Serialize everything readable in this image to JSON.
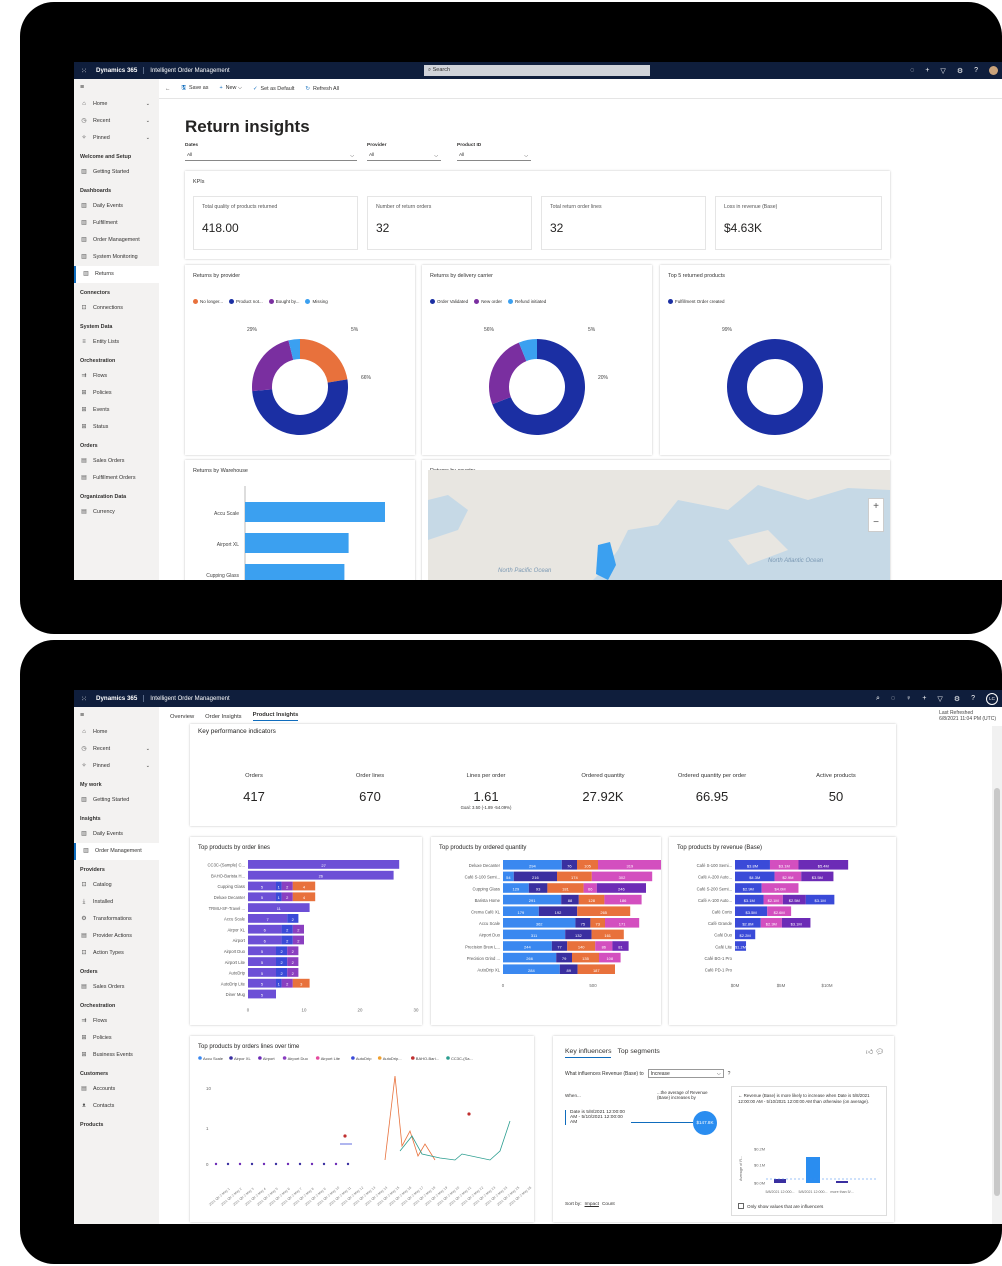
{
  "screen1": {
    "topbar": {
      "brand": "Dynamics 365",
      "app": "Intelligent Order Management",
      "search_placeholder": "Search"
    },
    "nav": [
      {
        "type": "item",
        "icon": "home-icon",
        "glyph": "⌂",
        "label": "Home",
        "chev": "⌄"
      },
      {
        "type": "item",
        "icon": "clock-icon",
        "glyph": "◷",
        "label": "Recent",
        "chev": "⌄"
      },
      {
        "type": "item",
        "icon": "pin-icon",
        "glyph": "✧",
        "label": "Pinned",
        "chev": "⌄"
      },
      {
        "type": "header",
        "label": "Welcome and Setup"
      },
      {
        "type": "item",
        "icon": "dashboard-icon",
        "glyph": "▥",
        "label": "Getting Started"
      },
      {
        "type": "header",
        "label": "Dashboards"
      },
      {
        "type": "item",
        "icon": "dashboard-icon",
        "glyph": "▥",
        "label": "Daily Events"
      },
      {
        "type": "item",
        "icon": "dashboard-icon",
        "glyph": "▥",
        "label": "Fulfillment"
      },
      {
        "type": "item",
        "icon": "dashboard-icon",
        "glyph": "▥",
        "label": "Order Management"
      },
      {
        "type": "item",
        "icon": "dashboard-icon",
        "glyph": "▥",
        "label": "System Monitoring"
      },
      {
        "type": "item",
        "icon": "dashboard-icon",
        "glyph": "▥",
        "label": "Returns",
        "selected": true
      },
      {
        "type": "header",
        "label": "Connectors"
      },
      {
        "type": "item",
        "icon": "connection-icon",
        "glyph": "⊡",
        "label": "Connections"
      },
      {
        "type": "header",
        "label": "System Data"
      },
      {
        "type": "item",
        "icon": "list-icon",
        "glyph": "≡",
        "label": "Entity Lists"
      },
      {
        "type": "header",
        "label": "Orchestration"
      },
      {
        "type": "item",
        "icon": "flow-icon",
        "glyph": "⇉",
        "label": "Flows"
      },
      {
        "type": "item",
        "icon": "policy-icon",
        "glyph": "⊞",
        "label": "Policies"
      },
      {
        "type": "item",
        "icon": "event-icon",
        "glyph": "⊞",
        "label": "Events"
      },
      {
        "type": "item",
        "icon": "status-icon",
        "glyph": "⊞",
        "label": "Status"
      },
      {
        "type": "header",
        "label": "Orders"
      },
      {
        "type": "item",
        "icon": "orders-icon",
        "glyph": "▤",
        "label": "Sales Orders"
      },
      {
        "type": "item",
        "icon": "orders-icon",
        "glyph": "▤",
        "label": "Fulfillment Orders"
      },
      {
        "type": "header",
        "label": "Organization Data"
      },
      {
        "type": "item",
        "icon": "currency-icon",
        "glyph": "▤",
        "label": "Currency"
      }
    ],
    "cmdbar": [
      {
        "icon": "save-icon",
        "glyph": "🖫",
        "label": "Save as"
      },
      {
        "icon": "add-icon",
        "glyph": "+",
        "label": "New ⌵"
      },
      {
        "icon": "check-icon",
        "glyph": "✓",
        "label": "Set as Default"
      },
      {
        "icon": "refresh-icon",
        "glyph": "↻",
        "label": "Refresh All"
      }
    ],
    "title": "Return insights",
    "filters": [
      {
        "label": "Dates",
        "value": "All"
      },
      {
        "label": "Provider",
        "value": "All"
      },
      {
        "label": "Product ID",
        "value": "All"
      }
    ],
    "kpi_title": "KPIs",
    "kpis": [
      {
        "label": "Total quality of products returned",
        "value": "418.00"
      },
      {
        "label": "Number of return orders",
        "value": "32"
      },
      {
        "label": "Total return order lines",
        "value": "32"
      },
      {
        "label": "Loss in revenue (Base)",
        "value": "$4.63K"
      }
    ],
    "donut_titles": [
      "Returns by provider",
      "Returns by delivery carrier",
      "Top 5 returned products"
    ],
    "bottom_titles": [
      "Returns by Warehouse",
      "Returns by country"
    ],
    "map_labels": [
      "North Pacific Ocean",
      "North Atlantic Ocean"
    ]
  },
  "chart_data": [
    {
      "type": "pie",
      "title": "Returns by provider",
      "series": [
        {
          "name": "No longer...",
          "value": 29,
          "color": "#e8713c"
        },
        {
          "name": "Product not...",
          "value": 66,
          "color": "#1b2fa3"
        },
        {
          "name": "Bought by...",
          "value": 29,
          "color": "#7a2fa0"
        },
        {
          "name": "Missing",
          "value": 5,
          "color": "#3ba0f0"
        }
      ],
      "data_labels": [
        "29%",
        "5%",
        "66%"
      ]
    },
    {
      "type": "pie",
      "title": "Returns by delivery carrier",
      "series": [
        {
          "name": "Order Validated",
          "value": 56,
          "color": "#1b2fa3"
        },
        {
          "name": "New order",
          "value": 20,
          "color": "#7a2fa0"
        },
        {
          "name": "Refund initiated",
          "value": 5,
          "color": "#3ba0f0"
        }
      ],
      "data_labels": [
        "56%",
        "5%",
        "20%"
      ]
    },
    {
      "type": "pie",
      "title": "Top 5 returned products",
      "series": [
        {
          "name": "Fulfillment Order created",
          "value": 99,
          "color": "#1b2fa3"
        }
      ],
      "data_labels": [
        "99%"
      ]
    },
    {
      "type": "bar",
      "title": "Returns by Warehouse",
      "categories": [
        "Accu Scale",
        "Airport XL",
        "Cupping Glass"
      ],
      "values": [
        100,
        74,
        71
      ]
    },
    {
      "type": "bar",
      "title": "Top products by order lines",
      "categories": [
        "CC3C-(Sample) C...",
        "BAHO-Barista H...",
        "Cupping Glass",
        "Deluxe Decanter",
        "TRMU-SF-Travel ...",
        "Accu Scale",
        "Airpor XL",
        "Airport",
        "Airport Duo",
        "Airport Lite",
        "AutoDrip",
        "AutoDrip Lite",
        "Diner Mug"
      ],
      "values": [
        27,
        26,
        15,
        15,
        11,
        11,
        11,
        11,
        11,
        11,
        11,
        11,
        8
      ],
      "segments": [
        [
          "27"
        ],
        [
          "26"
        ],
        [
          "5",
          "1",
          "2",
          "4"
        ],
        [
          "5",
          "1",
          "2",
          "4"
        ],
        [
          "11"
        ],
        [
          "7",
          "2"
        ],
        [
          "6",
          "2",
          "2"
        ],
        [
          "6",
          "2",
          "2"
        ],
        [
          "5",
          "2",
          "2"
        ],
        [
          "5",
          "2",
          "2"
        ],
        [
          "5",
          "2",
          "2"
        ],
        [
          "5",
          "1",
          "2",
          "3"
        ],
        [
          "5"
        ]
      ],
      "xticks": [
        "0",
        "10",
        "20",
        "30"
      ]
    },
    {
      "type": "bar",
      "title": "Top products by ordered quantity",
      "categories": [
        "Deluxe Decanter",
        "Café S-100 Semi...",
        "Cupping Glass",
        "Barista Home",
        "Crema Café XL",
        "Accu Scale",
        "Airport Duo",
        "Precision Brew L...",
        "Precision Grind ...",
        "AutoDrip XL"
      ],
      "segments": [
        [
          "294",
          "76",
          "105",
          "319"
        ],
        [
          "54",
          "216",
          "174",
          "302"
        ],
        [
          "129",
          "93",
          "181",
          "66",
          "246"
        ],
        [
          "291",
          "88",
          "128",
          "186"
        ],
        [
          "179",
          "192",
          "265"
        ],
        [
          "362",
          "75",
          "73",
          "171"
        ],
        [
          "311",
          "132",
          "161"
        ],
        [
          "244",
          "77",
          "140",
          "86",
          "81"
        ],
        [
          "266",
          "79",
          "135",
          "108"
        ],
        [
          "284",
          "89",
          "187"
        ]
      ],
      "xticks": [
        "0",
        "500"
      ]
    },
    {
      "type": "bar",
      "title": "Top products by revenue (Base)",
      "categories": [
        "Café S-100 Semi...",
        "Café A-200 Auto...",
        "Café S-200 Semi...",
        "Café A-100 Auto...",
        "Café Corto",
        "Café Grande",
        "Café Duo",
        "Café Lite",
        "Café BG-1 Pro",
        "Café PD-1 Pro"
      ],
      "segments": [
        [
          "$3.8M",
          "$3.1M",
          "$5.4M"
        ],
        [
          "$4.3M",
          "$2.9M",
          "$3.5M"
        ],
        [
          "$2.9M",
          "$4.0M"
        ],
        [
          "$3.1M",
          "$2.1M",
          "$2.5M",
          "$3.1M"
        ],
        [
          "$3.5M",
          "$2.6M"
        ],
        [
          "$2.8M",
          "$2.3M",
          "$3.1M"
        ],
        [
          "$2.2M"
        ],
        [
          "$1.2M"
        ],
        [],
        []
      ],
      "xticks": [
        "$0M",
        "$5M",
        "$10M"
      ]
    },
    {
      "type": "line",
      "title": "Top products by orders lines over time",
      "series": [
        {
          "name": "Accu Scale"
        },
        {
          "name": "Airpor XL"
        },
        {
          "name": "Airport"
        },
        {
          "name": "Airport Duo"
        },
        {
          "name": "Airport Lite"
        },
        {
          "name": "AutoDrip"
        },
        {
          "name": "AutoDrip..."
        },
        {
          "name": "BAHO-Bari..."
        },
        {
          "name": "CC3C-(Sa..."
        }
      ],
      "yticks": [
        "0",
        "1",
        "10"
      ]
    },
    {
      "type": "bar",
      "title": "Revenue (Base)",
      "categories": [
        "5/8/2021 12:000...",
        "5/8/2021 12:000...",
        "more than 5/..."
      ],
      "yticks": [
        "$0.0M",
        "$0.1M",
        "$0.2M"
      ],
      "ylabel": "Average of R..."
    }
  ],
  "screen2": {
    "topbar": {
      "brand": "Dynamics 365",
      "app": "Intelligent Order Management",
      "avatar": "LC"
    },
    "nav": [
      {
        "type": "item",
        "icon": "home-icon",
        "glyph": "⌂",
        "label": "Home"
      },
      {
        "type": "item",
        "icon": "clock-icon",
        "glyph": "◷",
        "label": "Recent",
        "chev": "⌄"
      },
      {
        "type": "item",
        "icon": "pin-icon",
        "glyph": "✧",
        "label": "Pinned",
        "chev": "⌄"
      },
      {
        "type": "header",
        "label": "My work"
      },
      {
        "type": "item",
        "icon": "dashboard-icon",
        "glyph": "▥",
        "label": "Getting Started"
      },
      {
        "type": "header",
        "label": "Insights"
      },
      {
        "type": "item",
        "icon": "dashboard-icon",
        "glyph": "▥",
        "label": "Daily Events"
      },
      {
        "type": "item",
        "icon": "dashboard-icon",
        "glyph": "▥",
        "label": "Order Management",
        "selected": true
      },
      {
        "type": "header",
        "label": "Providers"
      },
      {
        "type": "item",
        "icon": "catalog-icon",
        "glyph": "⊡",
        "label": "Catalog"
      },
      {
        "type": "item",
        "icon": "download-icon",
        "glyph": "⤓",
        "label": "Installed"
      },
      {
        "type": "item",
        "icon": "transform-icon",
        "glyph": "⚙",
        "label": "Transformations"
      },
      {
        "type": "item",
        "icon": "action-icon",
        "glyph": "▤",
        "label": "Provider Actions"
      },
      {
        "type": "item",
        "icon": "action-icon",
        "glyph": "⊡",
        "label": "Action Types"
      },
      {
        "type": "header",
        "label": "Orders"
      },
      {
        "type": "item",
        "icon": "orders-icon",
        "glyph": "▤",
        "label": "Sales Orders"
      },
      {
        "type": "header",
        "label": "Orchestration"
      },
      {
        "type": "item",
        "icon": "flow-icon",
        "glyph": "⇉",
        "label": "Flows"
      },
      {
        "type": "item",
        "icon": "policy-icon",
        "glyph": "⊞",
        "label": "Policies"
      },
      {
        "type": "item",
        "icon": "event-icon",
        "glyph": "⊞",
        "label": "Business Events"
      },
      {
        "type": "header",
        "label": "Customers"
      },
      {
        "type": "item",
        "icon": "accounts-icon",
        "glyph": "▤",
        "label": "Accounts"
      },
      {
        "type": "item",
        "icon": "contact-icon",
        "glyph": "ᴥ",
        "label": "Contacts"
      },
      {
        "type": "header",
        "label": "Products"
      }
    ],
    "tabs": [
      "Overview",
      "Order Insights",
      "Product Insights"
    ],
    "last_refreshed_label": "Last Refreshed",
    "last_refreshed_value": "6/8/2021 11:04 PM (UTC)",
    "kpi_header": "Key performance indicators",
    "kpis": [
      {
        "label": "Orders",
        "value": "417"
      },
      {
        "label": "Order lines",
        "value": "670"
      },
      {
        "label": "Lines per order",
        "value": "1.61",
        "goal": "Goal: 3.50 (-1.89 -54.09%)"
      },
      {
        "label": "Ordered quantity",
        "value": "27.92K"
      },
      {
        "label": "Ordered quantity per order",
        "value": "66.95"
      },
      {
        "label": "Active products",
        "value": "50"
      }
    ],
    "influencers": {
      "tabs": [
        "Key influencers",
        "Top segments"
      ],
      "question": "What influences Revenue (Base) to",
      "select_value": "Increase",
      "question_mark": "?",
      "when": "When...",
      "avg_text": "...the average of Revenue (Base) increases by",
      "condition": "Date is 5/8/2021 12:00:00 AM - 5/10/2021 12:00:00 AM",
      "bubble": "$147.8K",
      "explain": "Revenue (Base) is more likely to increase when Date is 5/8/2021 12:00:00 AM - 5/10/2021 12:00:00 AM than otherwise (on average).",
      "sort_label": "Sort by:",
      "sort_impact": "Impact",
      "sort_count": "Count",
      "checkbox_label": "Only show values that are influencers"
    }
  }
}
